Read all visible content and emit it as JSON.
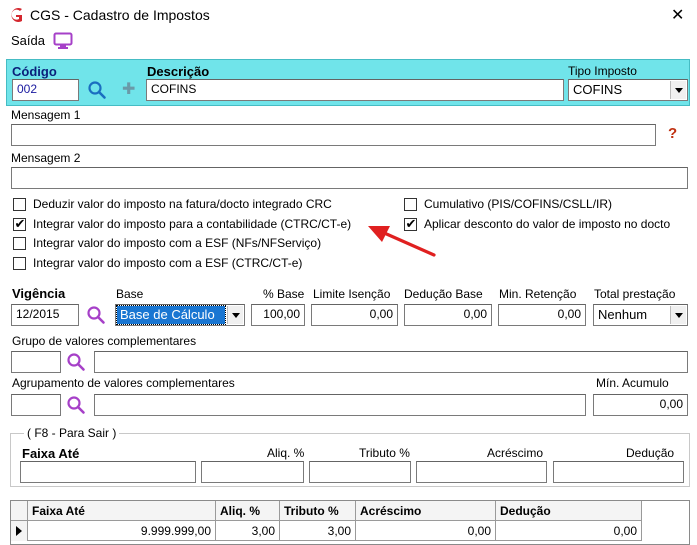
{
  "window": {
    "title": "CGS - Cadastro de Impostos",
    "close_glyph": "✕"
  },
  "menu": {
    "exit_label": "Saída"
  },
  "header": {
    "code_label": "Código",
    "code_value": "002",
    "desc_label": "Descrição",
    "desc_value": "COFINS",
    "type_label": "Tipo Imposto",
    "type_value": "COFINS"
  },
  "messages": {
    "msg1_label": "Mensagem 1",
    "msg1_value": "",
    "msg2_label": "Mensagem 2",
    "msg2_value": "",
    "help_glyph": "?"
  },
  "options": {
    "left": [
      {
        "label": "Deduzir valor do imposto na fatura/docto integrado CRC",
        "checked": false
      },
      {
        "label": "Integrar valor do imposto para a contabilidade (CTRC/CT-e)",
        "checked": true
      },
      {
        "label": "Integrar valor do imposto com a ESF (NFs/NFServiço)",
        "checked": false
      },
      {
        "label": "Integrar valor do imposto com a ESF (CTRC/CT-e)",
        "checked": false
      }
    ],
    "right": [
      {
        "label": "Cumulativo (PIS/COFINS/CSLL/IR)",
        "checked": false
      },
      {
        "label": "Aplicar desconto do valor de imposto no docto",
        "checked": true
      }
    ],
    "check_glyph": "✔"
  },
  "params": {
    "vigencia_label": "Vigência",
    "vigencia_value": "12/2015",
    "base_label": "Base",
    "base_value": "Base de Cálculo",
    "pct_base_label": "% Base",
    "pct_base_value": "100,00",
    "limite_label": "Limite Isenção",
    "limite_value": "0,00",
    "deducao_base_label": "Dedução Base",
    "deducao_base_value": "0,00",
    "min_ret_label": "Min. Retenção",
    "min_ret_value": "0,00",
    "total_prest_label": "Total prestação",
    "total_prest_value": "Nenhum"
  },
  "groups": {
    "grupo_label": "Grupo de valores complementares",
    "agrup_label": "Agrupamento de valores complementares",
    "min_acum_label": "Mín. Acumulo",
    "min_acum_value": "0,00"
  },
  "faixa": {
    "legend": "( F8 - Para Sair )",
    "faixa_label": "Faixa Até",
    "aliq_label": "Aliq. %",
    "tributo_label": "Tributo %",
    "acrescimo_label": "Acréscimo",
    "deducao_label": "Dedução"
  },
  "grid": {
    "columns": [
      "Faixa Até",
      "Aliq. %",
      "Tributo %",
      "Acréscimo",
      "Dedução"
    ],
    "rows": [
      [
        "9.999.999,00",
        "3,00",
        "3,00",
        "0,00",
        "0,00"
      ]
    ]
  },
  "colors": {
    "header_band": "#70e4ea",
    "arrow": "#e02020",
    "logo": "#d4272e",
    "icon_purple": "#a640c8"
  }
}
